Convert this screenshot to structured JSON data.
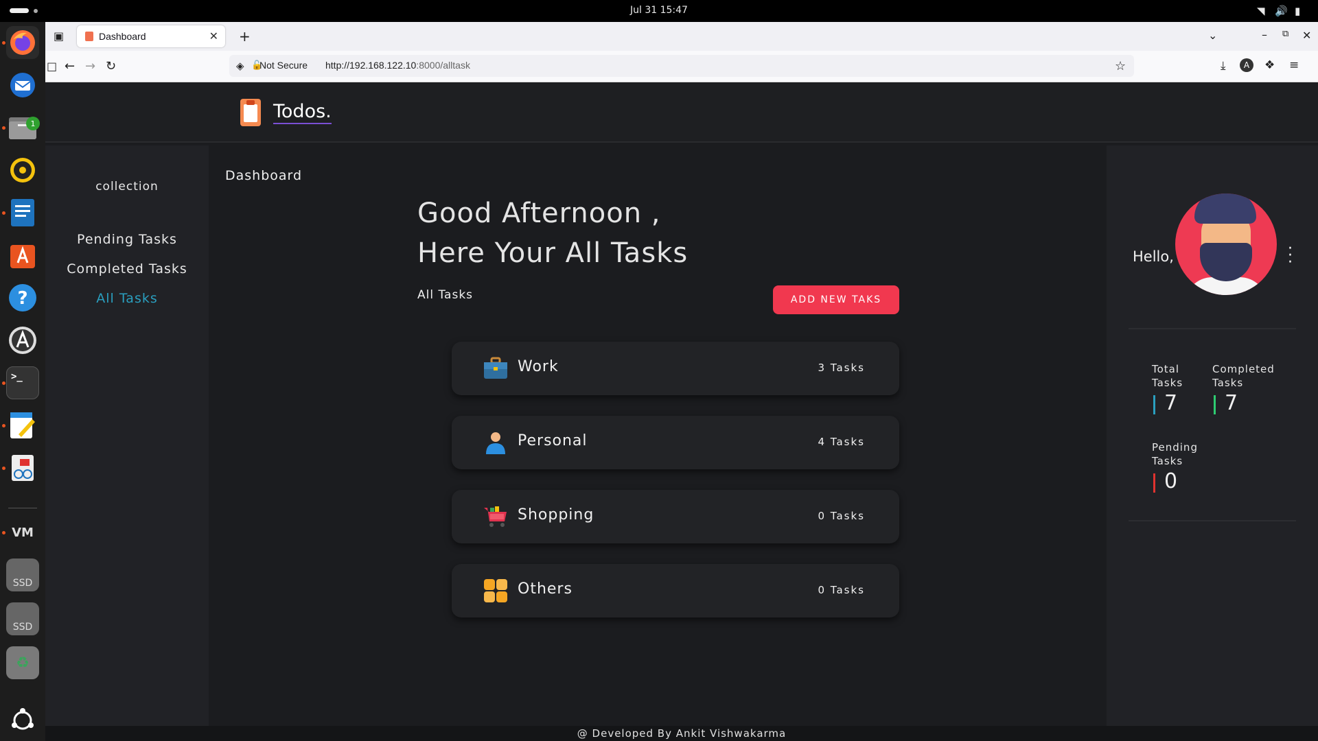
{
  "system": {
    "clock": "Jul 31  15:47"
  },
  "dock": {
    "items": [
      "firefox-icon",
      "thunderbird-icon",
      "files-icon",
      "rhythmbox-icon",
      "writer-icon",
      "app-center-icon",
      "help-icon",
      "software-updater-icon",
      "terminal-icon",
      "text-editor-icon",
      "document-viewer-icon",
      "vm-icon",
      "ssd-drive-icon",
      "ssd-drive-icon",
      "trash-icon",
      "ubuntu-apps-icon"
    ],
    "files_badge": "1",
    "ssd_label": "SSD"
  },
  "browser": {
    "tab_title": "Dashboard",
    "security_label": "Not Secure",
    "url_host": "http://192.168.122.10",
    "url_rest": ":8000/alltask"
  },
  "app": {
    "logo_text": "Todos.",
    "dashboard_title": "Dashboard",
    "greeting_line1": "Good Afternoon ,",
    "greeting_line2": "Here Your All Tasks",
    "section_title": "All Tasks",
    "add_button_label": "ADD NEW TAKS",
    "footer": "@ Developed By Ankit Vishwakarma"
  },
  "sidebar": {
    "title": "collection",
    "links": [
      {
        "label": "Pending Tasks",
        "active": false
      },
      {
        "label": "Completed Tasks",
        "active": false
      },
      {
        "label": "All Tasks",
        "active": true
      }
    ],
    "active_color": "#2a9fbf"
  },
  "categories": [
    {
      "name": "Work",
      "count": "3 Tasks",
      "icon": "briefcase-icon"
    },
    {
      "name": "Personal",
      "count": "4 Tasks",
      "icon": "person-icon"
    },
    {
      "name": "Shopping",
      "count": "0 Tasks",
      "icon": "shopping-cart-icon"
    },
    {
      "name": "Others",
      "count": "0 Tasks",
      "icon": "grid-icon"
    }
  ],
  "profile": {
    "hello": "Hello,",
    "stats": [
      {
        "label_line1": "Total",
        "label_line2": "Tasks",
        "value": "7",
        "color": "#2a9fbf"
      },
      {
        "label_line1": "Completed",
        "label_line2": "Tasks",
        "value": "7",
        "color": "#2ecc71"
      },
      {
        "label_line1": "Pending",
        "label_line2": "Tasks",
        "value": "0",
        "color": "#e0332f"
      }
    ]
  },
  "colors": {
    "accent": "#f1384f",
    "background": "#1b1c1f",
    "panel": "#212226"
  }
}
